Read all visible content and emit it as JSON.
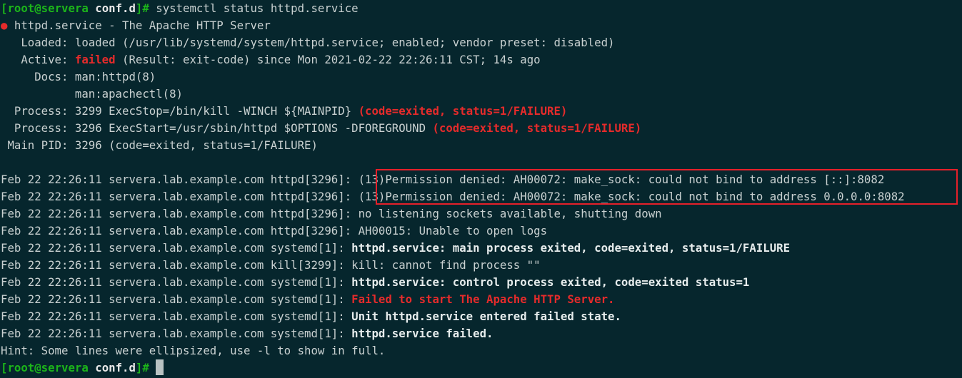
{
  "prompt": {
    "open_bracket": "[",
    "user_host": "root@servera",
    "dir": "conf.d",
    "close": "]#"
  },
  "command": " systemctl status httpd.service",
  "status": {
    "dot": "●",
    "service_line": " httpd.service - The Apache HTTP Server",
    "loaded": "   Loaded: loaded (/usr/lib/systemd/system/httpd.service; enabled; vendor preset: disabled)",
    "active_label": "   Active: ",
    "active_state": "failed",
    "active_rest": " (Result: exit-code) since Mon 2021-02-22 22:26:11 CST; 14s ago",
    "docs_1": "     Docs: man:httpd(8)",
    "docs_2": "           man:apachectl(8)",
    "process_1": "  Process: 3299 ExecStop=/bin/kill -WINCH ${MAINPID} ",
    "process_1_result": "(code=exited, status=1/FAILURE)",
    "process_2": "  Process: 3296 ExecStart=/usr/sbin/httpd $OPTIONS -DFOREGROUND ",
    "process_2_result": "(code=exited, status=1/FAILURE)",
    "main_pid": " Main PID: 3296 (code=exited, status=1/FAILURE)"
  },
  "logs": [
    {
      "prefix": "Feb 22 22:26:11 servera.lab.example.com httpd[3296]: ",
      "message": "(13)Permission denied: AH00072: make_sock: could not bind to address [::]:8082"
    },
    {
      "prefix": "Feb 22 22:26:11 servera.lab.example.com httpd[3296]: ",
      "message": "(13)Permission denied: AH00072: make_sock: could not bind to address 0.0.0.0:8082"
    },
    {
      "prefix": "Feb 22 22:26:11 servera.lab.example.com httpd[3296]: ",
      "message": "no listening sockets available, shutting down"
    },
    {
      "prefix": "Feb 22 22:26:11 servera.lab.example.com httpd[3296]: ",
      "message": "AH00015: Unable to open logs"
    },
    {
      "prefix": "Feb 22 22:26:11 servera.lab.example.com systemd[1]: ",
      "message": "httpd.service: main process exited, code=exited, status=1/FAILURE"
    },
    {
      "prefix": "Feb 22 22:26:11 servera.lab.example.com kill[3299]: ",
      "message": "kill: cannot find process \"\""
    },
    {
      "prefix": "Feb 22 22:26:11 servera.lab.example.com systemd[1]: ",
      "message": "httpd.service: control process exited, code=exited status=1"
    },
    {
      "prefix": "Feb 22 22:26:11 servera.lab.example.com systemd[1]: ",
      "message": "Failed to start The Apache HTTP Server."
    },
    {
      "prefix": "Feb 22 22:26:11 servera.lab.example.com systemd[1]: ",
      "message": "Unit httpd.service entered failed state."
    },
    {
      "prefix": "Feb 22 22:26:11 servera.lab.example.com systemd[1]: ",
      "message": "httpd.service failed."
    }
  ],
  "hint": "Hint: Some lines were ellipsized, use -l to show in full.",
  "colors": {
    "background": "#06262d",
    "text": "#c9d1d1",
    "prompt_green": "#1cb51a",
    "error_red": "#e52b2b",
    "highlight_box": "#e5202a"
  }
}
